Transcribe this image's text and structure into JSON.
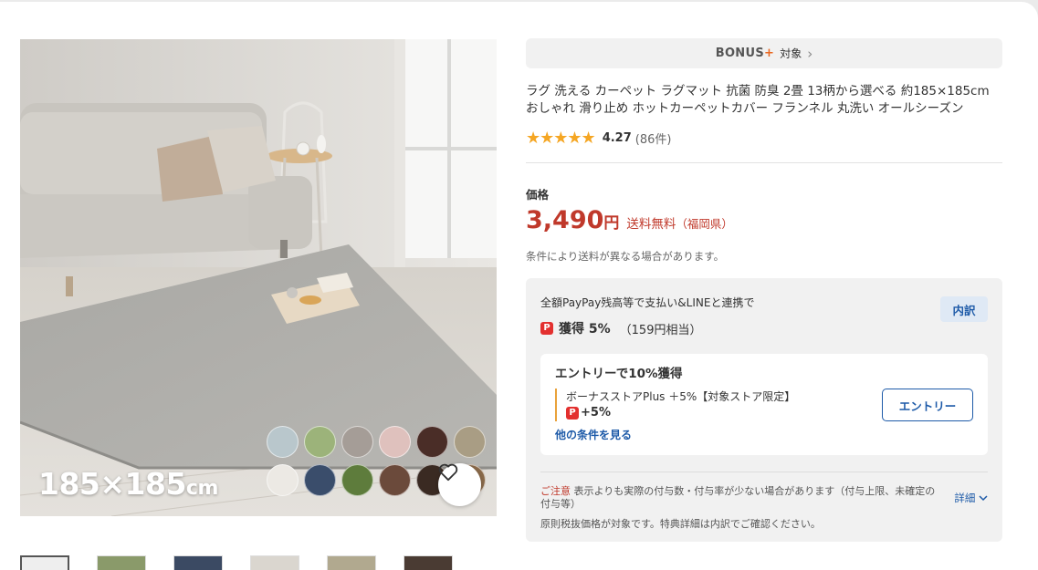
{
  "image": {
    "size_caption": "185×185",
    "size_unit": "cm",
    "swatch_colors": [
      "#b9c7cc",
      "#9cb37a",
      "#a59d97",
      "#dfc1bd",
      "#4a2d27",
      "#a99d84",
      "#ece9e4",
      "#3a4d6b",
      "#5e7c3c",
      "#6b4a3b",
      "#3a2a22",
      "#8a6a4a"
    ]
  },
  "bonus": {
    "logo_main": "BONUS",
    "logo_plus": "+",
    "label": "対象",
    "chevron": "›"
  },
  "product": {
    "title": "ラグ 洗える カーペット ラグマット 抗菌 防臭 2畳 13柄から選べる 約185×185cm おしゃれ 滑り止め ホットカーペットカバー フランネル 丸洗い オールシーズン",
    "stars": "★★★★★",
    "rating": "4.27",
    "review_count": "(86件)"
  },
  "price": {
    "label": "価格",
    "amount": "3,490",
    "yen": "円",
    "shipping": "送料無料",
    "shipping_from": "（福岡県）",
    "shipping_note": "条件により送料が異なる場合があります。"
  },
  "paypay": {
    "condition": "全額PayPay残高等で支払い&LINEと連携で",
    "icon_glyph": "P",
    "gain_label": "獲得 5%",
    "gain_sub": "（159円相当）",
    "breakdown_button": "内訳",
    "entry_title": "エントリーで10%獲得",
    "entry_detail": "ボーナスストアPlus ＋5%【対象ストア限定】",
    "entry_points": "+5%",
    "other_conditions": "他の条件を見る",
    "entry_button": "エントリー"
  },
  "caution": {
    "label": "ご注意",
    "text": " 表示よりも実際の付与数・付与率が少ない場合があります（付与上限、未確定の付与等）",
    "detail_link": "詳細",
    "tax_note": "原則税抜価格が対象です。特典詳細は内訳でご確認ください。"
  }
}
